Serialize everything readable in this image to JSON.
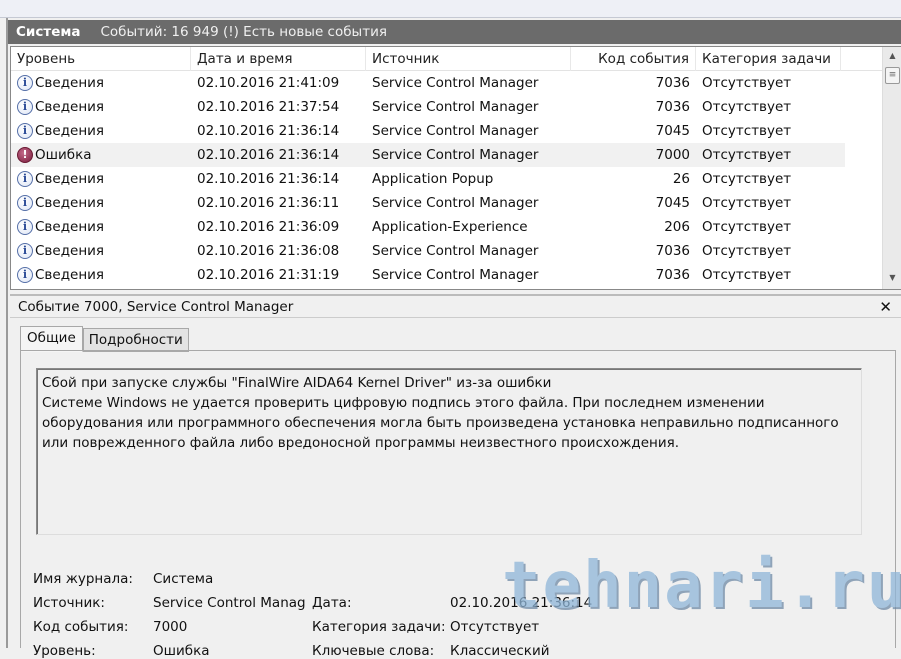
{
  "titlebar": {
    "log": "Система",
    "summary": "Событий: 16 949 (!) Есть новые события"
  },
  "columns": [
    "Уровень",
    "Дата и время",
    "Источник",
    "Код события",
    "Категория задачи"
  ],
  "rows": [
    {
      "icon": "info",
      "level": "Сведения",
      "date": "02.10.2016 21:41:09",
      "source": "Service Control Manager",
      "code": "7036",
      "category": "Отсутствует"
    },
    {
      "icon": "info",
      "level": "Сведения",
      "date": "02.10.2016 21:37:54",
      "source": "Service Control Manager",
      "code": "7036",
      "category": "Отсутствует"
    },
    {
      "icon": "info",
      "level": "Сведения",
      "date": "02.10.2016 21:36:14",
      "source": "Service Control Manager",
      "code": "7045",
      "category": "Отсутствует"
    },
    {
      "icon": "error",
      "level": "Ошибка",
      "date": "02.10.2016 21:36:14",
      "source": "Service Control Manager",
      "code": "7000",
      "category": "Отсутствует",
      "selected": true
    },
    {
      "icon": "info",
      "level": "Сведения",
      "date": "02.10.2016 21:36:14",
      "source": "Application Popup",
      "code": "26",
      "category": "Отсутствует"
    },
    {
      "icon": "info",
      "level": "Сведения",
      "date": "02.10.2016 21:36:11",
      "source": "Service Control Manager",
      "code": "7045",
      "category": "Отсутствует"
    },
    {
      "icon": "info",
      "level": "Сведения",
      "date": "02.10.2016 21:36:09",
      "source": "Application-Experience",
      "code": "206",
      "category": "Отсутствует"
    },
    {
      "icon": "info",
      "level": "Сведения",
      "date": "02.10.2016 21:36:08",
      "source": "Service Control Manager",
      "code": "7036",
      "category": "Отсутствует"
    },
    {
      "icon": "info",
      "level": "Сведения",
      "date": "02.10.2016 21:31:19",
      "source": "Service Control Manager",
      "code": "7036",
      "category": "Отсутствует"
    }
  ],
  "detail": {
    "title": "Событие 7000, Service Control Manager",
    "tabs": [
      "Общие",
      "Подробности"
    ],
    "description": "Сбой при запуске службы \"FinalWire AIDA64 Kernel Driver\" из-за ошибки\nСистеме Windows не удается проверить цифровую подпись этого файла. При последнем изменении оборудования или программного обеспечения могла быть произведена установка неправильно подписанного или поврежденного файла либо вредоносной программы неизвестного происхождения.",
    "fields": {
      "log_label": "Имя журнала:",
      "log": "Система",
      "source_label": "Источник:",
      "source": "Service Control Manag",
      "date_label": "Дата:",
      "date": "02.10.2016 21:36:14",
      "code_label": "Код события:",
      "code": "7000",
      "category_label": "Категория задачи:",
      "category": "Отсутствует",
      "level_label": "Уровень:",
      "level": "Ошибка",
      "keywords_label": "Ключевые слова:",
      "keywords": "Классический"
    }
  },
  "watermark": "tehnari.ru"
}
